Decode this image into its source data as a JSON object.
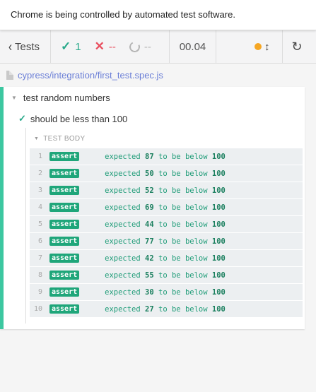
{
  "banner": {
    "text": "Chrome is being controlled by automated test software."
  },
  "stats": {
    "tests_label": "Tests",
    "passed": "1",
    "failed": "--",
    "pending": "--",
    "duration": "00.04"
  },
  "spec": {
    "path": "cypress/integration/first_test.spec.js"
  },
  "suite": {
    "title": "test random numbers",
    "test_title": "should be less than 100",
    "body_label": "TEST BODY",
    "commands": [
      {
        "num": "1",
        "name": "assert",
        "prefix": "expected ",
        "value": "87",
        "middle": " to be below ",
        "limit": "100"
      },
      {
        "num": "2",
        "name": "assert",
        "prefix": "expected ",
        "value": "50",
        "middle": " to be below ",
        "limit": "100"
      },
      {
        "num": "3",
        "name": "assert",
        "prefix": "expected ",
        "value": "52",
        "middle": " to be below ",
        "limit": "100"
      },
      {
        "num": "4",
        "name": "assert",
        "prefix": "expected ",
        "value": "69",
        "middle": " to be below ",
        "limit": "100"
      },
      {
        "num": "5",
        "name": "assert",
        "prefix": "expected ",
        "value": "44",
        "middle": " to be below ",
        "limit": "100"
      },
      {
        "num": "6",
        "name": "assert",
        "prefix": "expected ",
        "value": "77",
        "middle": " to be below ",
        "limit": "100"
      },
      {
        "num": "7",
        "name": "assert",
        "prefix": "expected ",
        "value": "42",
        "middle": " to be below ",
        "limit": "100"
      },
      {
        "num": "8",
        "name": "assert",
        "prefix": "expected ",
        "value": "55",
        "middle": " to be below ",
        "limit": "100"
      },
      {
        "num": "9",
        "name": "assert",
        "prefix": "expected ",
        "value": "30",
        "middle": " to be below ",
        "limit": "100"
      },
      {
        "num": "10",
        "name": "assert",
        "prefix": "expected ",
        "value": "27",
        "middle": " to be below ",
        "limit": "100"
      }
    ]
  },
  "icons": {
    "back": "chevron-left-icon",
    "passed": "check-icon",
    "failed": "x-icon",
    "pending": "circle-notch-icon",
    "running": "yellow-dot-icon",
    "auto_scroll": "arrows-vertical-icon",
    "reload": "reload-icon",
    "file": "file-icon"
  },
  "colors": {
    "passed": "#28a98a",
    "failed": "#e94f5f",
    "pending": "#b5b5b5",
    "spec_link": "#6b7fd7",
    "runnable_border": "#3cc7a0",
    "assert_badge": "#1fa67a",
    "running_dot": "#f5a623"
  }
}
